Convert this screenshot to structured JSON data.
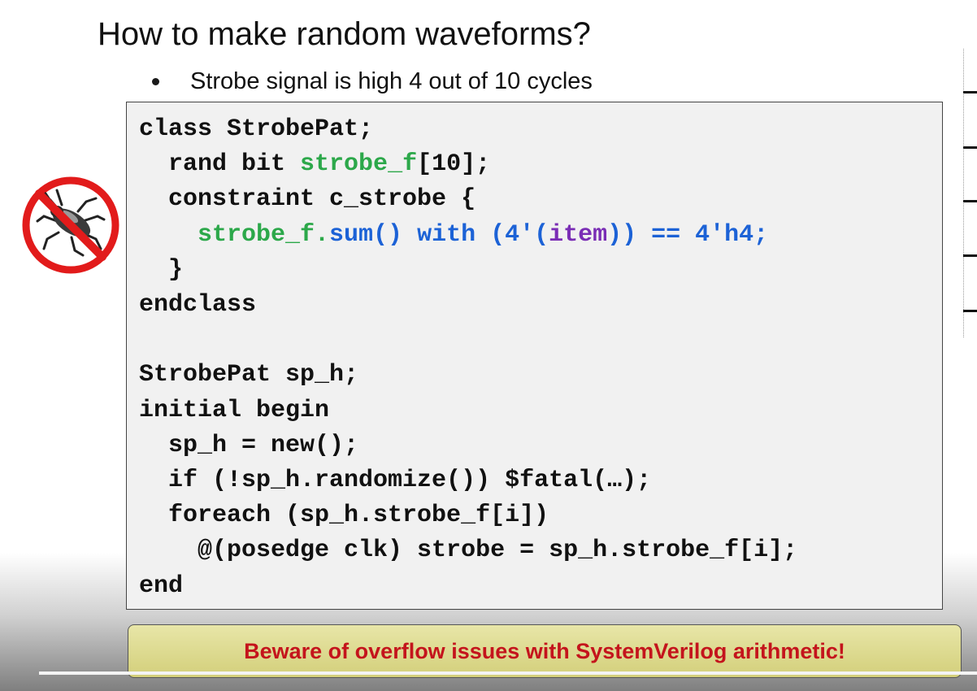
{
  "slide": {
    "title": "How to make random waveforms?",
    "bullet": "Strobe signal is high 4 out of 10 cycles",
    "warning": "Beware of overflow issues with SystemVerilog arithmetic!",
    "icon": "no-bugs-icon"
  },
  "code": {
    "l1": "class StrobePat;",
    "l2_a": "  rand bit ",
    "l2_b": "strobe_f",
    "l2_c": "[10];",
    "l3": "  constraint c_strobe {",
    "l4_a": "    ",
    "l4_b": "strobe_f.",
    "l4_c": "sum() with (4'(",
    "l4_d": "item",
    "l4_e": ")) == 4'h4;",
    "l5": "  }",
    "l6": "endclass",
    "l7": "",
    "l8": "StrobePat sp_h;",
    "l9": "initial begin",
    "l10": "  sp_h = new();",
    "l11": "  if (!sp_h.randomize()) $fatal(…);",
    "l12": "  foreach (sp_h.strobe_f[i])",
    "l13": "    @(posedge clk) strobe = sp_h.strobe_f[i];",
    "l14": "end"
  },
  "colors": {
    "keyword_green": "#2ca84a",
    "keyword_blue": "#1c62d6",
    "keyword_purple": "#7a2db5",
    "warning_text": "#c4141c",
    "warning_bg": "#d9d58a"
  }
}
